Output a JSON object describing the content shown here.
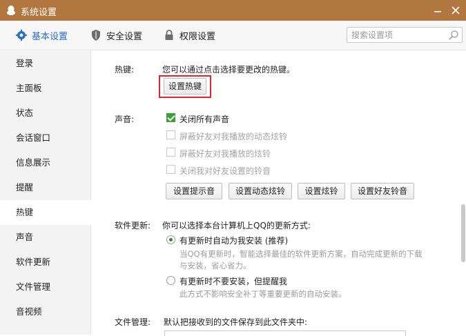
{
  "window": {
    "title": "系统设置",
    "titlebar_color": "#b2773f",
    "minimize_icon": "minimize-icon",
    "close_icon": "close-icon"
  },
  "toolbar": {
    "tabs": [
      {
        "label": "基本设置",
        "icon": "gear-icon",
        "active": true
      },
      {
        "label": "安全设置",
        "icon": "shield-icon"
      },
      {
        "label": "权限设置",
        "icon": "lock-icon"
      }
    ],
    "search": {
      "placeholder": "搜索设置项",
      "icon": "search-icon"
    },
    "accent_color": "#2b6ec8"
  },
  "sidebar": {
    "items": [
      {
        "label": "登录"
      },
      {
        "label": "主面板"
      },
      {
        "label": "状态"
      },
      {
        "label": "会话窗口"
      },
      {
        "label": "信息展示"
      },
      {
        "label": "提醒"
      },
      {
        "label": "热键",
        "active": true
      },
      {
        "label": "声音"
      },
      {
        "label": "软件更新"
      },
      {
        "label": "文件管理"
      },
      {
        "label": "音视频"
      }
    ]
  },
  "hotkey": {
    "label": "热键:",
    "desc": "您可以通过点击选择要更改的热键。",
    "button": "设置热键",
    "highlight_color": "#e3242b"
  },
  "sound": {
    "label": "声音:",
    "options": [
      {
        "label": "关闭所有声音",
        "checked": true,
        "enabled": true
      },
      {
        "label": "屏蔽好友对我播放的动态炫铃",
        "checked": false,
        "enabled": false
      },
      {
        "label": "屏蔽好友对我播放的炫铃",
        "checked": false,
        "enabled": false
      },
      {
        "label": "关闭我对好友设置的铃音",
        "checked": false,
        "enabled": false
      }
    ],
    "buttons": [
      "设置提示音",
      "设置动态炫铃",
      "设置炫铃",
      "设置好友铃音"
    ],
    "check_color": "#3aa03a"
  },
  "update": {
    "label": "软件更新:",
    "desc": "你可以选择本台计算机上QQ的更新方式:",
    "options": [
      {
        "label": "有更新时自动为我安装 (推荐)",
        "selected": true,
        "hint1": "当QQ有更新时，智能选择最佳的软件更新方案，自动完成更新的下载",
        "hint2": "与安装，省心省力。"
      },
      {
        "label": "有更新时不要安装，但提醒我",
        "selected": false,
        "hint1": "此方式不影响安全补丁等重要更新的自动安装。"
      }
    ]
  },
  "file": {
    "label": "文件管理:",
    "desc": "默认把接收到的文件保存到此文件夹中:"
  }
}
